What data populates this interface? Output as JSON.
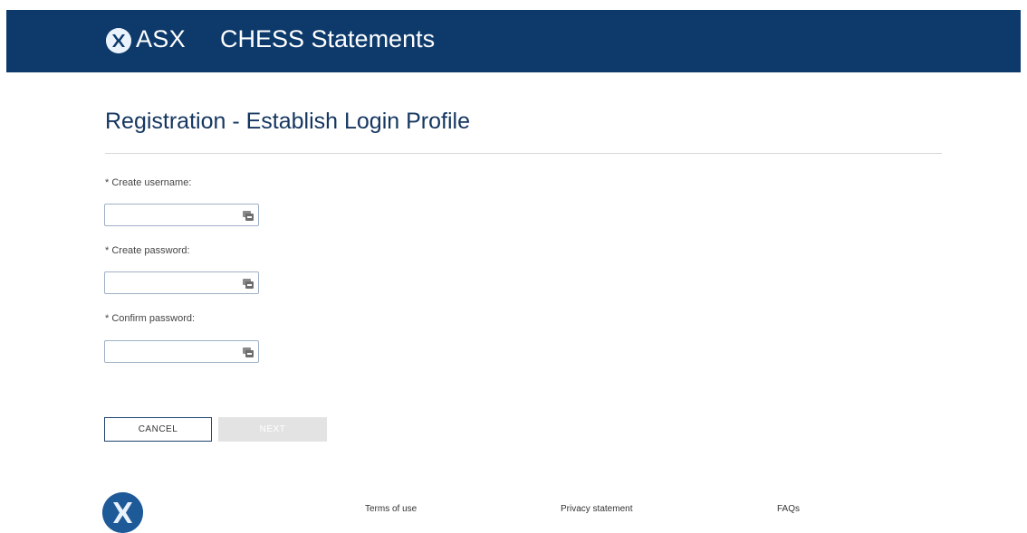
{
  "header": {
    "brand": "ASX",
    "app_title": "CHESS Statements",
    "background_color": "#0d3a6b"
  },
  "main": {
    "title": "Registration - Establish Login Profile",
    "fields": [
      {
        "label": "* Create username:",
        "value": "",
        "icon": "key-icon"
      },
      {
        "label": "* Create password:",
        "value": "",
        "icon": "key-icon"
      },
      {
        "label": "* Confirm password:",
        "value": "",
        "icon": "key-icon"
      }
    ]
  },
  "buttons": {
    "cancel_label": "CANCEL",
    "next_label": "NEXT",
    "next_disabled": true
  },
  "footer": {
    "logo_icon": "asx-logo-icon",
    "links": [
      {
        "label": "Terms of use"
      },
      {
        "label": "Privacy statement"
      },
      {
        "label": "FAQs"
      }
    ]
  }
}
